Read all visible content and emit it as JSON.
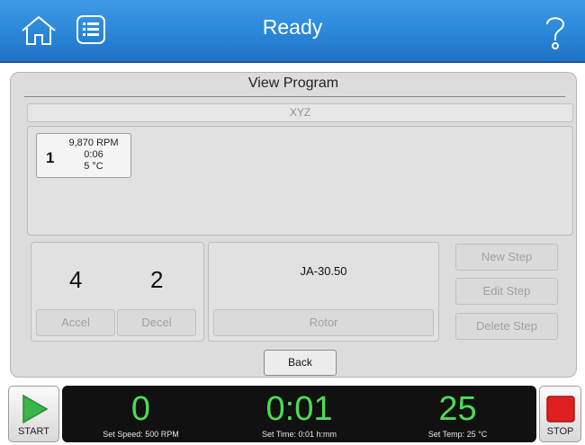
{
  "header": {
    "title": "Ready",
    "icons": {
      "home": "home-icon",
      "menu": "list-icon",
      "help": "help-icon"
    }
  },
  "panel": {
    "title": "View Program",
    "program_name": "XYZ"
  },
  "steps": [
    {
      "number": "1",
      "speed": "9,870 RPM",
      "time": "0:06",
      "temp": "5 °C"
    }
  ],
  "accel_decel": {
    "accel_value": "4",
    "decel_value": "2",
    "accel_label": "Accel",
    "decel_label": "Decel"
  },
  "rotor": {
    "name": "JA-30.50",
    "button_label": "Rotor"
  },
  "step_buttons": {
    "new_step": "New Step",
    "edit_step": "Edit Step",
    "delete_step": "Delete Step"
  },
  "back_label": "Back",
  "controls": {
    "start_label": "START",
    "stop_label": "STOP"
  },
  "status": {
    "speed_value": "0",
    "speed_set": "Set Speed: 500 RPM",
    "time_value": "0:01",
    "time_set": "Set Time: 0:01 h:mm",
    "temp_value": "25",
    "temp_set": "Set Temp: 25 °C"
  },
  "colors": {
    "header_blue": "#2a86d8",
    "readout_green": "#4ddc56",
    "start_green": "#3ab54a",
    "stop_red": "#e02020"
  }
}
